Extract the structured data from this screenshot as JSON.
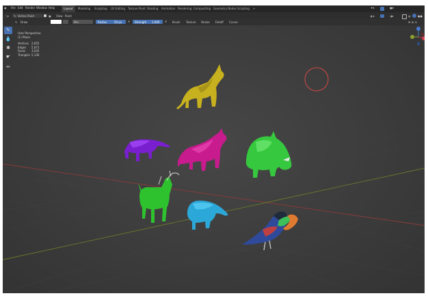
{
  "menu": {
    "items": [
      "File",
      "Edit",
      "Render",
      "Window",
      "Help"
    ],
    "workspaces": [
      "Layout",
      "Modeling",
      "Sculpting",
      "UV Editing",
      "Texture Paint",
      "Shading",
      "Animation",
      "Rendering",
      "Compositing",
      "Geometry Nodes",
      "Scripting",
      "+"
    ],
    "active_workspace": "Layout"
  },
  "header": {
    "mode": "Vertex Paint",
    "view": "View",
    "paint": "Paint"
  },
  "tool_settings": {
    "brush": "Draw",
    "blend": "Mix",
    "radius_label": "Radius",
    "radius_value": "50 px",
    "strength_label": "Strength",
    "strength_value": "1.000",
    "brush_menu": "Brush",
    "texture_menu": "Texture",
    "stroke_menu": "Stroke",
    "falloff_menu": "Falloff",
    "cursor_menu": "Cursor"
  },
  "overlay": {
    "view_name": "User Perspective",
    "object_name": "(1) Plane",
    "stats": [
      {
        "label": "Vertices",
        "value": "2,655"
      },
      {
        "label": "Edges",
        "value": "5,071"
      },
      {
        "label": "Faces",
        "value": "3,035"
      },
      {
        "label": "Triangles",
        "value": "5,136"
      }
    ]
  },
  "colors": {
    "active_color": "#ffffff",
    "accent_blue": "#4772b3",
    "topbar": "#262626",
    "viewport_bg": "#3d3d3d",
    "brush_cursor": "#d44a45",
    "axis_x": "#8b3a3a",
    "axis_y": "#6b7a2a"
  },
  "icons": {
    "tools": [
      "draw-brush-icon",
      "blur-icon",
      "average-icon",
      "smear-icon",
      "annotate-icon"
    ],
    "right_tools": [
      "zoom-icon",
      "pan-icon",
      "camera-icon",
      "ortho-grid-icon"
    ]
  },
  "animals": [
    {
      "name": "yellow-cat",
      "color": "#c8b11e"
    },
    {
      "name": "purple-anteater",
      "color": "#7a1fcf"
    },
    {
      "name": "magenta-cat",
      "color": "#c81b8e"
    },
    {
      "name": "green-boar",
      "color": "#36c83e"
    },
    {
      "name": "green-deer",
      "color": "#2fc22f"
    },
    {
      "name": "cyan-anteater",
      "color": "#2ba8d8"
    },
    {
      "name": "toucan",
      "color": "#3f7a3f"
    }
  ]
}
